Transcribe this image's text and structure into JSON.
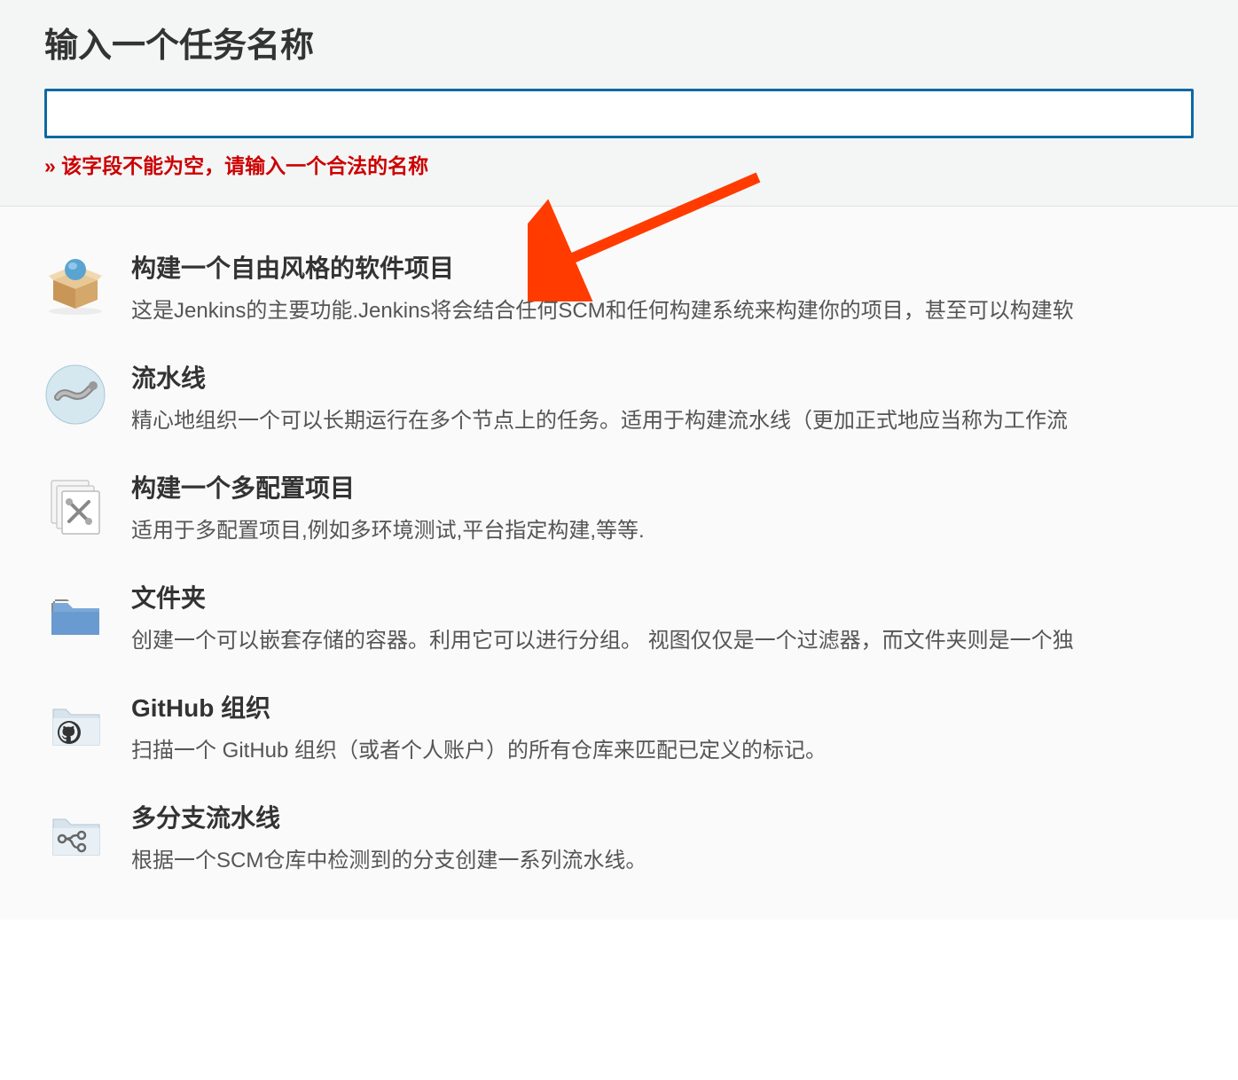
{
  "header": {
    "title": "输入一个任务名称",
    "validation_error": "» 该字段不能为空，请输入一个合法的名称"
  },
  "input": {
    "value": "",
    "placeholder": ""
  },
  "job_types": [
    {
      "icon": "freestyle-project-icon",
      "title": "构建一个自由风格的软件项目",
      "desc": "这是Jenkins的主要功能.Jenkins将会结合任何SCM和任何构建系统来构建你的项目，甚至可以构建软"
    },
    {
      "icon": "pipeline-icon",
      "title": "流水线",
      "desc": "精心地组织一个可以长期运行在多个节点上的任务。适用于构建流水线（更加正式地应当称为工作流"
    },
    {
      "icon": "multiconfig-icon",
      "title": "构建一个多配置项目",
      "desc": "适用于多配置项目,例如多环境测试,平台指定构建,等等."
    },
    {
      "icon": "folder-icon",
      "title": "文件夹",
      "desc": "创建一个可以嵌套存储的容器。利用它可以进行分组。 视图仅仅是一个过滤器，而文件夹则是一个独"
    },
    {
      "icon": "github-org-icon",
      "title": "GitHub 组织",
      "desc": "扫描一个 GitHub 组织（或者个人账户）的所有仓库来匹配已定义的标记。"
    },
    {
      "icon": "multibranch-pipeline-icon",
      "title": "多分支流水线",
      "desc": "根据一个SCM仓库中检测到的分支创建一系列流水线。"
    }
  ]
}
